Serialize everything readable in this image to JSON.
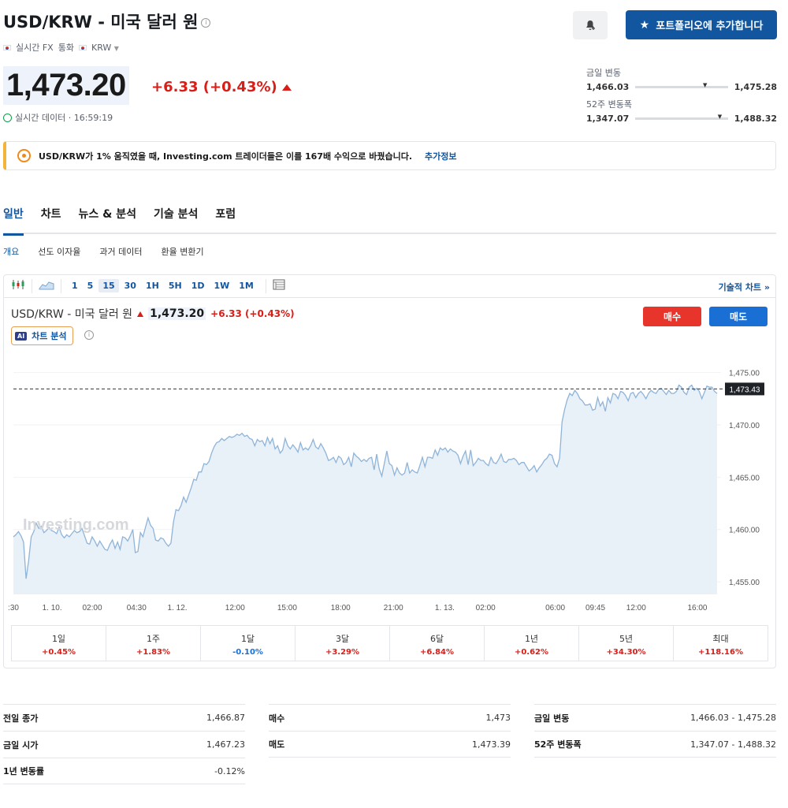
{
  "header": {
    "title": "USD/KRW - 미국 달러 원",
    "info_glyph": "i",
    "meta_realtime": "실시간 FX",
    "meta_currency_label": "통화",
    "meta_currency_value": "KRW",
    "price": "1,473.20",
    "change": "+6.33 (+0.43%)",
    "realtime_text": "실시간 데이터 · 16:59:19",
    "add_portfolio_label": "포트폴리오에 추가합니다"
  },
  "ranges": {
    "day_label": "금일 변동",
    "day_low": "1,466.03",
    "day_high": "1,475.28",
    "day_position": 0.73,
    "week52_label": "52주 변동폭",
    "week52_low": "1,347.07",
    "week52_high": "1,488.32",
    "week52_position": 0.89
  },
  "banner": {
    "text": "USD/KRW가 1% 움직였을 때, Investing.com 트레이더들은 이를 167배 수익으로 바꿨습니다.",
    "link": "추가정보"
  },
  "tabs": [
    "일반",
    "차트",
    "뉴스 & 분석",
    "기술 분석",
    "포럼"
  ],
  "subtabs": [
    "개요",
    "선도 이자율",
    "과거 데이터",
    "환율 변환기"
  ],
  "toolbar": {
    "timeframes": [
      "1",
      "5",
      "15",
      "30",
      "1H",
      "5H",
      "1D",
      "1W",
      "1M"
    ],
    "active": "15",
    "technical_chart": "기술적 차트 »"
  },
  "chart_header": {
    "name": "USD/KRW - 미국 달러 원",
    "price": "1,473.20",
    "change": "+6.33 (+0.43%)",
    "ai_badge": "AI",
    "ai_label": "차트 분석",
    "buy": "매수",
    "sell": "매도"
  },
  "chart_data": {
    "type": "area",
    "watermark": "Investing.com",
    "x_tick_labels": [
      ":30",
      "1. 10.",
      "02:00",
      "04:30",
      "1. 12.",
      "12:00",
      "15:00",
      "18:00",
      "21:00",
      "1. 13.",
      "02:00",
      "06:00",
      "09:45",
      "12:00",
      "16:00"
    ],
    "y_ticks": [
      "1,475.00",
      "1,470.00",
      "1,465.00",
      "1,460.00",
      "1,455.00"
    ],
    "y_tick_values": [
      1475,
      1470,
      1465,
      1460,
      1455
    ],
    "ylim": [
      1453.8,
      1476.4
    ],
    "last_value_label": "1,473.43",
    "last_value": 1473.43,
    "values": [
      1459.3,
      1459.5,
      1459.8,
      1459.4,
      1458.8,
      1455.3,
      1457.0,
      1459.3,
      1459.8,
      1460.6,
      1460.1,
      1460.3,
      1459.7,
      1459.9,
      1460.2,
      1459.9,
      1459.8,
      1459.6,
      1460.2,
      1459.5,
      1459.2,
      1459.5,
      1459.3,
      1459.6,
      1459.9,
      1459.7,
      1459.8,
      1460.1,
      1459.4,
      1458.7,
      1458.6,
      1459.3,
      1458.9,
      1458.4,
      1458.9,
      1458.5,
      1458.1,
      1458.0,
      1458.6,
      1459.0,
      1458.2,
      1458.8,
      1458.1,
      1459.3,
      1459.2,
      1458.9,
      1459.4,
      1460.0,
      1457.8,
      1457.9,
      1459.7,
      1459.3,
      1460.2,
      1461.1,
      1460.4,
      1460.1,
      1459.0,
      1458.9,
      1459.2,
      1459.1,
      1458.7,
      1458.4,
      1458.7,
      1460.7,
      1461.9,
      1461.8,
      1462.3,
      1463.1,
      1462.6,
      1463.3,
      1464.0,
      1464.8,
      1464.7,
      1465.5,
      1465.5,
      1466.3,
      1466.2,
      1466.5,
      1467.3,
      1467.9,
      1468.3,
      1468.4,
      1468.7,
      1468.5,
      1468.7,
      1468.9,
      1468.8,
      1468.9,
      1469.1,
      1469.0,
      1469.2,
      1468.9,
      1469.0,
      1468.7,
      1468.6,
      1468.0,
      1468.6,
      1468.4,
      1468.5,
      1468.0,
      1468.8,
      1468.2,
      1468.7,
      1467.7,
      1468.0,
      1467.3,
      1467.6,
      1468.7,
      1468.0,
      1467.7,
      1468.1,
      1467.8,
      1467.4,
      1468.3,
      1467.6,
      1467.8,
      1467.6,
      1468.0,
      1468.6,
      1467.9,
      1467.7,
      1468.2,
      1467.8,
      1467.3,
      1466.6,
      1466.7,
      1466.9,
      1466.4,
      1467.0,
      1466.8,
      1466.2,
      1466.4,
      1466.9,
      1466.0,
      1467.3,
      1467.0,
      1466.8,
      1466.5,
      1466.7,
      1466.5,
      1466.8,
      1466.9,
      1465.7,
      1467.2,
      1465.8,
      1465.1,
      1466.3,
      1467.5,
      1466.3,
      1466.1,
      1465.2,
      1465.9,
      1465.4,
      1465.2,
      1465.4,
      1466.4,
      1465.4,
      1465.7,
      1465.5,
      1465.4,
      1466.1,
      1466.9,
      1466.0,
      1466.9,
      1466.9,
      1466.8,
      1467.6,
      1467.1,
      1467.8,
      1467.6,
      1467.8,
      1467.4,
      1467.7,
      1467.5,
      1467.4,
      1467.1,
      1466.3,
      1467.0,
      1467.5,
      1466.2,
      1467.6,
      1466.1,
      1466.4,
      1466.8,
      1466.6,
      1466.6,
      1466.3,
      1466.1,
      1466.9,
      1466.4,
      1466.3,
      1466.7,
      1467.2,
      1466.5,
      1466.4,
      1466.7,
      1466.7,
      1466.8,
      1466.6,
      1466.2,
      1466.4,
      1466.4,
      1466.0,
      1465.6,
      1465.8,
      1466.1,
      1465.5,
      1465.9,
      1466.2,
      1466.6,
      1466.8,
      1467.2,
      1467.1,
      1466.3,
      1466.0,
      1466.8,
      1470.3,
      1471.5,
      1472.4,
      1473.0,
      1472.8,
      1473.3,
      1473.0,
      1472.5,
      1472.3,
      1471.9,
      1471.9,
      1472.0,
      1471.4,
      1471.5,
      1472.6,
      1471.8,
      1472.2,
      1471.3,
      1472.6,
      1472.1,
      1473.0,
      1472.9,
      1472.5,
      1473.2,
      1473.1,
      1472.8,
      1472.3,
      1473.0,
      1473.1,
      1472.6,
      1473.0,
      1473.2,
      1472.9,
      1472.5,
      1473.0,
      1473.3,
      1473.1,
      1473.0,
      1473.4,
      1473.5,
      1473.2,
      1472.9,
      1473.3,
      1473.0,
      1473.0,
      1473.2,
      1473.8,
      1473.6,
      1473.1,
      1472.9,
      1473.6,
      1473.8,
      1473.3,
      1473.5,
      1473.2,
      1472.5,
      1473.1,
      1473.7,
      1473.6,
      1473.6,
      1473.2,
      1473.0
    ]
  },
  "performance": [
    {
      "label": "1일",
      "value": "+0.45%",
      "dir": "pos"
    },
    {
      "label": "1주",
      "value": "+1.83%",
      "dir": "pos"
    },
    {
      "label": "1달",
      "value": "-0.10%",
      "dir": "neg"
    },
    {
      "label": "3달",
      "value": "+3.29%",
      "dir": "pos"
    },
    {
      "label": "6달",
      "value": "+6.84%",
      "dir": "pos"
    },
    {
      "label": "1년",
      "value": "+0.62%",
      "dir": "pos"
    },
    {
      "label": "5년",
      "value": "+34.30%",
      "dir": "pos"
    },
    {
      "label": "최대",
      "value": "+118.16%",
      "dir": "pos"
    }
  ],
  "stats": {
    "col1": [
      {
        "label": "전일 종가",
        "value": "1,466.87"
      },
      {
        "label": "금일 시가",
        "value": "1,467.23"
      },
      {
        "label": "1년 변동률",
        "value": "-0.12%"
      }
    ],
    "col2": [
      {
        "label": "매수",
        "value": "1,473"
      },
      {
        "label": "매도",
        "value": "1,473.39"
      }
    ],
    "col3": [
      {
        "label": "금일 변동",
        "value": "1,466.03 - 1,475.28"
      },
      {
        "label": "52주 변동폭",
        "value": "1,347.07 - 1,488.32"
      }
    ]
  },
  "colors": {
    "accent": "#1256a0",
    "positive": "#d91e18",
    "negative": "#1a6fd4",
    "line": "#8fb4d9",
    "area": "#e8f0f8"
  }
}
